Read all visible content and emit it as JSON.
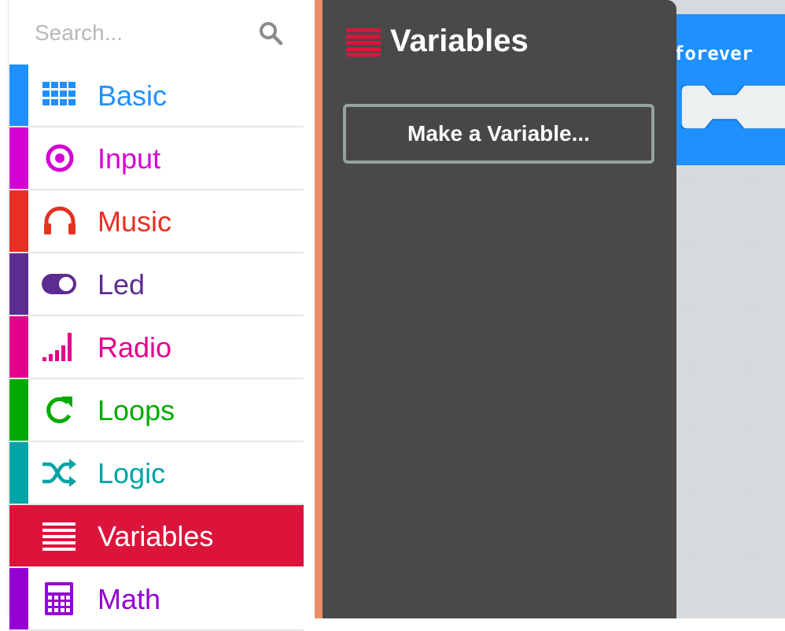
{
  "search": {
    "placeholder": "Search...",
    "icon": "search-icon"
  },
  "categories": [
    {
      "label": "Basic",
      "color": "#1e90ff",
      "icon": "grid-icon"
    },
    {
      "label": "Input",
      "color": "#d400d4",
      "icon": "target-icon"
    },
    {
      "label": "Music",
      "color": "#e63022",
      "icon": "headphones-icon"
    },
    {
      "label": "Led",
      "color": "#5c2d91",
      "icon": "toggle-icon"
    },
    {
      "label": "Radio",
      "color": "#e3008c",
      "icon": "signal-bars-icon"
    },
    {
      "label": "Loops",
      "color": "#00aa00",
      "icon": "refresh-icon"
    },
    {
      "label": "Logic",
      "color": "#00a4a6",
      "icon": "shuffle-icon"
    },
    {
      "label": "Variables",
      "color": "#dc143c",
      "icon": "list-lines-icon",
      "selected": true
    },
    {
      "label": "Math",
      "color": "#9400d3",
      "icon": "calculator-icon"
    }
  ],
  "flyout": {
    "title": "Variables",
    "title_icon": "list-lines-icon",
    "button_label": "Make a Variable...",
    "background": "#4a4848"
  },
  "workspace": {
    "block_label": "forever",
    "block_color": "#1e90ff"
  }
}
